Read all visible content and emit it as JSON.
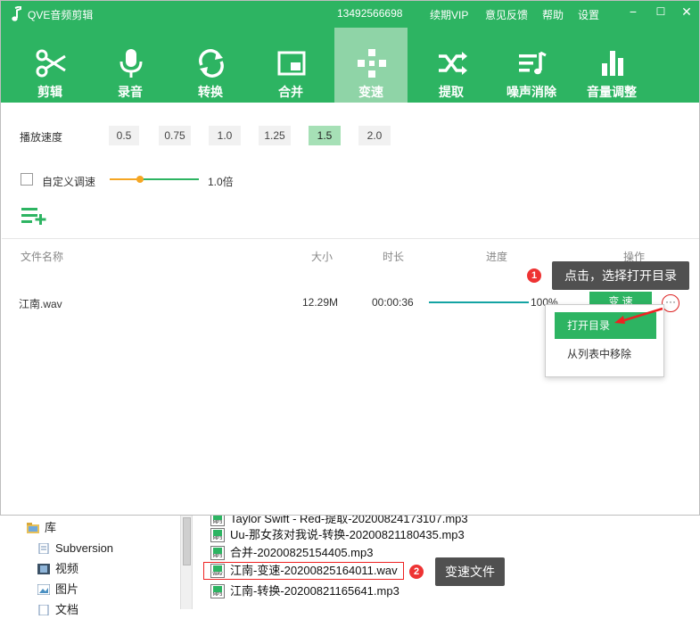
{
  "titlebar": {
    "app_title": "QVE音频剪辑",
    "phone": "13492566698",
    "vip": "续期VIP",
    "feedback": "意见反馈",
    "help": "帮助",
    "settings": "设置",
    "min": "−",
    "max": "☐",
    "close": "✕"
  },
  "toolbar": {
    "tools": [
      {
        "label": "剪辑",
        "icon": "scissors-icon"
      },
      {
        "label": "录音",
        "icon": "microphone-icon"
      },
      {
        "label": "转换",
        "icon": "convert-icon"
      },
      {
        "label": "合并",
        "icon": "merge-icon"
      },
      {
        "label": "变速",
        "icon": "speed-icon",
        "active": true
      },
      {
        "label": "提取",
        "icon": "shuffle-icon"
      },
      {
        "label": "噪声消除",
        "icon": "noise-icon"
      },
      {
        "label": "音量调整",
        "icon": "volume-bars-icon"
      }
    ]
  },
  "speed": {
    "label": "播放速度",
    "options": [
      "0.5",
      "0.75",
      "1.0",
      "1.25",
      "1.5",
      "2.0"
    ],
    "selected": "1.5",
    "custom_label": "自定义调速",
    "custom_checked": false,
    "custom_value": "1.0倍",
    "slider_fraction": 0.34
  },
  "table": {
    "headers": {
      "name": "文件名称",
      "size": "大小",
      "duration": "时长",
      "progress": "进度",
      "action": "操作"
    },
    "rows": [
      {
        "name": "江南.wav",
        "size": "12.29M",
        "duration": "00:00:36",
        "progress": "100%",
        "action": "变 速",
        "progress_value": 1.0
      }
    ]
  },
  "menu": {
    "items": [
      "打开目录",
      "从列表中移除"
    ]
  },
  "annotations": {
    "callout1": {
      "badge": "1",
      "text": "点击，选择打开目录"
    },
    "callout2": {
      "badge": "2",
      "text": "变速文件"
    }
  },
  "explorer": {
    "tree": [
      {
        "label": "库",
        "icon": "library-folder-icon"
      },
      {
        "label": "Subversion",
        "icon": "document-icon"
      },
      {
        "label": "视频",
        "icon": "video-icon"
      },
      {
        "label": "图片",
        "icon": "picture-icon"
      },
      {
        "label": "文档",
        "icon": "document-icon"
      }
    ],
    "files": [
      {
        "name": "Taylor Swift - Red-提取-20200824173107.mp3",
        "ext": "MP3"
      },
      {
        "name": "Uu-那女孩对我说-转换-20200821180435.mp3",
        "ext": "MP3"
      },
      {
        "name": "合并-20200825154405.mp3",
        "ext": "MP3"
      },
      {
        "name": "江南-变速-20200825164011.wav",
        "ext": "WAV"
      },
      {
        "name": "江南-转换-20200821165641.mp3",
        "ext": "MP3"
      }
    ]
  },
  "colors": {
    "brand_green": "#2db462",
    "active_tab": "#8fd4a7",
    "selected_speed": "#a6e0b6",
    "slider_orange": "#f5a623",
    "progress_teal": "#14a3a3",
    "callout_bg": "#505050",
    "badge_red": "#e33333"
  }
}
